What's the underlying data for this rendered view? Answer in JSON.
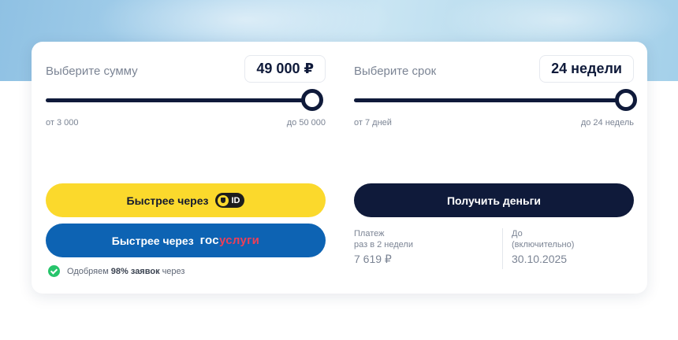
{
  "amount": {
    "label": "Выберите сумму",
    "value": "49 000 ₽",
    "min_label": "от 3 000",
    "max_label": "до 50 000",
    "slider_level": 0.98
  },
  "term": {
    "label": "Выберите срок",
    "value": "24 недели",
    "min_label": "от 7 дней",
    "max_label": "до 24 недель",
    "slider_level": 1.0
  },
  "buttons": {
    "tid_label": "Быстрее через",
    "tid_badge": "ID",
    "gos_label": "Быстрее через",
    "gos_logo_part1": "гос",
    "gos_logo_part2": "услуги",
    "get_money": "Получить деньги"
  },
  "approve": {
    "prefix": "Одобряем",
    "bold": "98% заявок",
    "suffix": "через"
  },
  "payment": {
    "label_line1": "Платеж",
    "label_line2": "раз в 2 недели",
    "value": "7 619 ₽"
  },
  "due": {
    "label_line1": "До",
    "label_line2": "(включительно)",
    "value": "30.10.2025"
  },
  "colors": {
    "dark": "#0f1a3a",
    "yellow": "#fbd92c",
    "blue": "#0d63b3",
    "gos_red": "#ee3f58",
    "green": "#27c46b"
  }
}
